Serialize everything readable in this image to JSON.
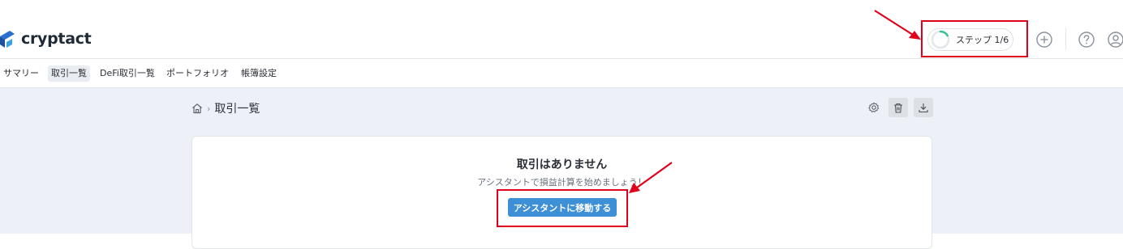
{
  "app": {
    "name": "cryptact"
  },
  "header": {
    "step_label": "ステップ 1/6",
    "step_progress": 0.1667
  },
  "nav": {
    "items": [
      {
        "label": "サマリー"
      },
      {
        "label": "取引一覧",
        "active": true
      },
      {
        "label": "DeFi取引一覧"
      },
      {
        "label": "ポートフォリオ"
      },
      {
        "label": "帳簿設定"
      }
    ]
  },
  "breadcrumb": {
    "current": "取引一覧",
    "separator": "›"
  },
  "empty_state": {
    "title": "取引はありません",
    "subtitle": "アシスタントで損益計算を始めましょう！",
    "button_label": "アシスタントに移動する"
  },
  "colors": {
    "accent": "#3d8fd6",
    "progress": "#34c38f",
    "annotation_red": "#e0001b",
    "main_background": "#edf1f7"
  },
  "icons": [
    "plus-circle-icon",
    "help-circle-icon",
    "user-circle-icon",
    "home-icon",
    "gear-icon",
    "trash-icon",
    "download-icon"
  ]
}
